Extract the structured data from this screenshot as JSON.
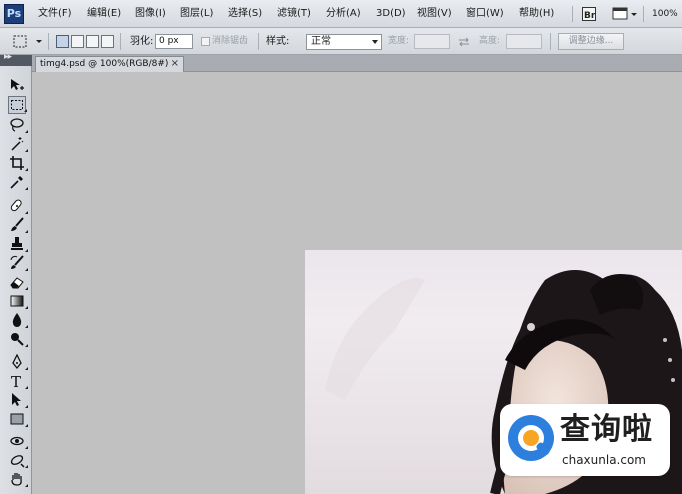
{
  "app": {
    "logo": "Ps",
    "zoom_level": "100%"
  },
  "menu": [
    "文件(F)",
    "编辑(E)",
    "图像(I)",
    "图层(L)",
    "选择(S)",
    "滤镜(T)",
    "分析(A)",
    "3D(D)",
    "视图(V)",
    "窗口(W)",
    "帮助(H)"
  ],
  "menubar_icons": [
    "bridge-icon",
    "screen-mode-icon",
    "chevron-down-icon"
  ],
  "options": {
    "feather_label": "羽化:",
    "feather_value": "0 px",
    "antialias_label": "消除锯齿",
    "style_label": "样式:",
    "style_value": "正常",
    "width_label": "宽度:",
    "height_label": "高度:",
    "refine_edge_label": "调整边缘...",
    "swap_icon": "swap-arrows-icon"
  },
  "document": {
    "tab_label": "timg4.psd @ 100%(RGB/8#)",
    "close_glyph": "×"
  },
  "tools": [
    "move-tool-icon",
    "rectangular-marquee-icon",
    "lasso-icon",
    "magic-wand-icon",
    "crop-icon",
    "eyedropper-icon",
    "spot-healing-brush-icon",
    "brush-icon",
    "clone-stamp-icon",
    "history-brush-icon",
    "eraser-icon",
    "gradient-icon",
    "blur-icon",
    "dodge-icon",
    "pen-icon",
    "type-icon",
    "path-selection-icon",
    "rectangle-shape-icon",
    "3d-rotate-icon",
    "3d-orbit-icon",
    "hand-icon"
  ],
  "watermark": {
    "title": "查询啦",
    "url": "chaxunla.com"
  },
  "colors": {
    "canvas": "#c1c1c1",
    "watermark_blue": "#2c7fdc",
    "watermark_orange": "#f6a623"
  }
}
